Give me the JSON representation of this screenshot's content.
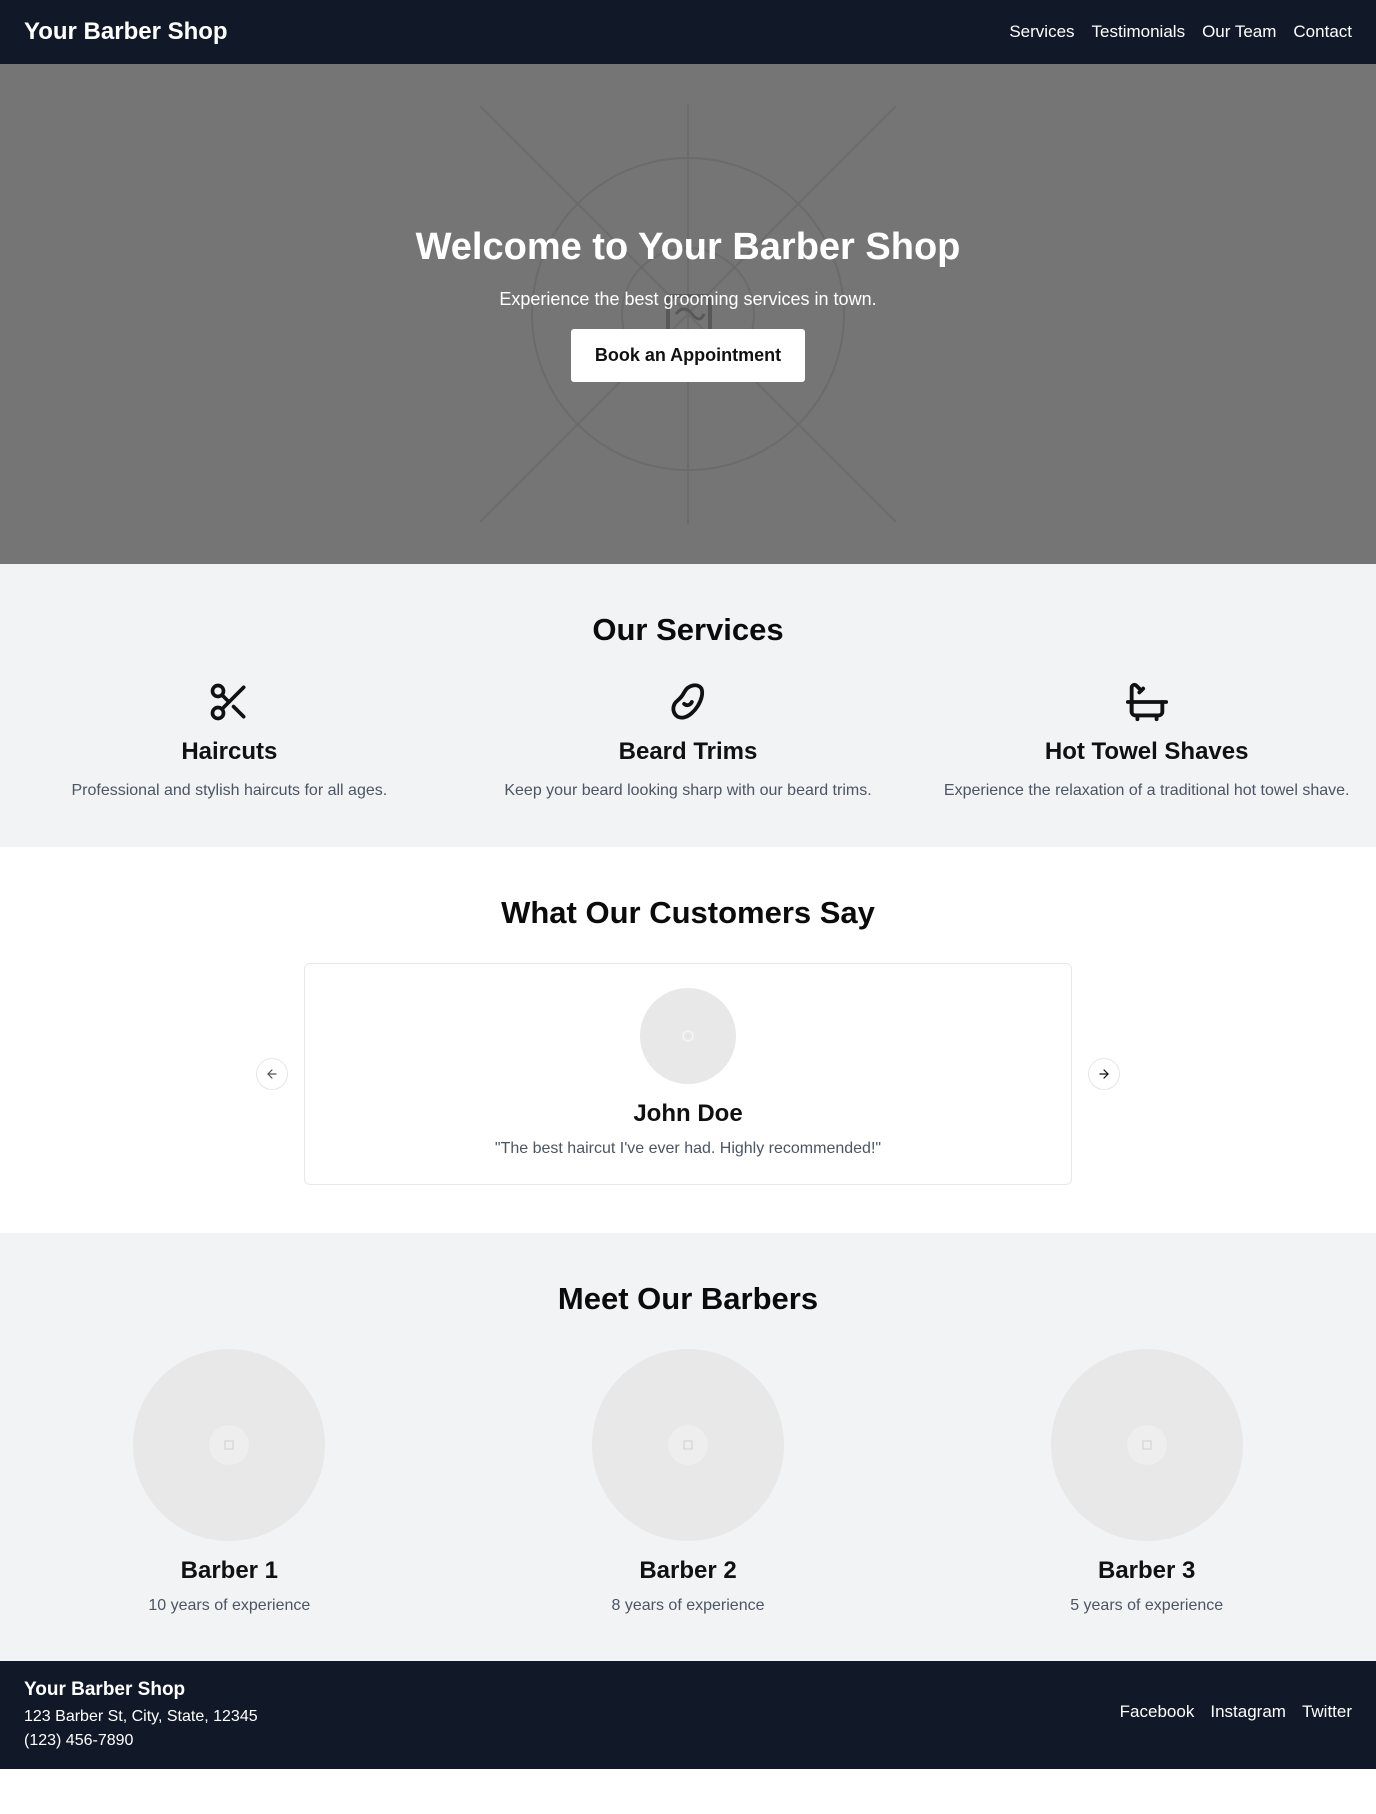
{
  "nav": {
    "brand": "Your Barber Shop",
    "links": [
      "Services",
      "Testimonials",
      "Our Team",
      "Contact"
    ]
  },
  "hero": {
    "title": "Welcome to Your Barber Shop",
    "subtitle": "Experience the best grooming services in town.",
    "cta": "Book an Appointment"
  },
  "services": {
    "title": "Our Services",
    "items": [
      {
        "icon": "scissors-icon",
        "name": "Haircuts",
        "desc": "Professional and stylish haircuts for all ages."
      },
      {
        "icon": "beard-icon",
        "name": "Beard Trims",
        "desc": "Keep your beard looking sharp with our beard trims."
      },
      {
        "icon": "bathtub-icon",
        "name": "Hot Towel Shaves",
        "desc": "Experience the relaxation of a traditional hot towel shave."
      }
    ]
  },
  "testimonials": {
    "title": "What Our Customers Say",
    "current": {
      "name": "John Doe",
      "quote": "\"The best haircut I've ever had. Highly recommended!\""
    }
  },
  "team": {
    "title": "Meet Our Barbers",
    "barbers": [
      {
        "name": "Barber 1",
        "experience": "10 years of experience"
      },
      {
        "name": "Barber 2",
        "experience": "8 years of experience"
      },
      {
        "name": "Barber 3",
        "experience": "5 years of experience"
      }
    ]
  },
  "footer": {
    "brand": "Your Barber Shop",
    "address": "123 Barber St, City, State, 12345",
    "phone": "(123) 456-7890",
    "social": [
      "Facebook",
      "Instagram",
      "Twitter"
    ]
  },
  "colors": {
    "nav_bg": "#111827",
    "hero_bg": "#757575",
    "section_alt_bg": "#f2f3f5",
    "muted_text": "#4b5563"
  }
}
